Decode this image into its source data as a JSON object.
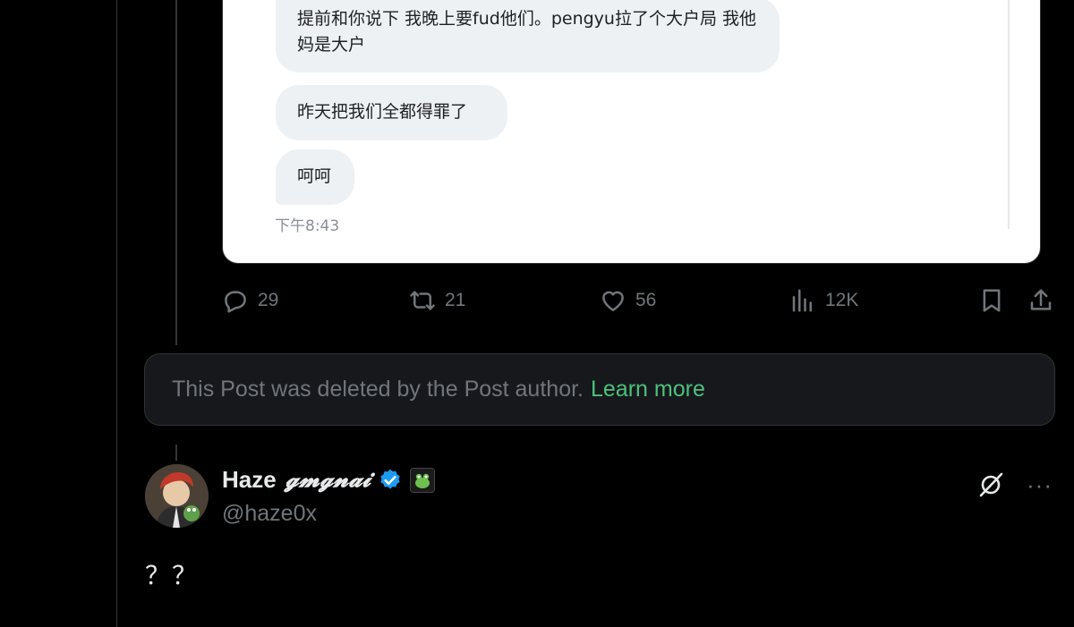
{
  "media": {
    "bubble_1": "提前和你说下 我晚上要fud他们。pengyu拉了个大户局 我他妈是大户",
    "bubble_2": "昨天把我们全都得罪了",
    "bubble_3": "呵呵",
    "time": "下午8:43"
  },
  "actions": {
    "replies": "29",
    "reposts": "21",
    "likes": "56",
    "views": "12K"
  },
  "deleted_notice": {
    "text": "This Post was deleted by the Post author.",
    "link": "Learn more"
  },
  "author": {
    "name": "Haze",
    "name_fancy": "𝓰𝓶𝓰𝓷𝓪𝓲",
    "handle": "@haze0x"
  },
  "tweet": {
    "text": "？？"
  },
  "colors": {
    "background": "#000000",
    "muted": "#71767b",
    "link": "#4ec07c",
    "verified": "#1d9bf0"
  },
  "icons": [
    "reply-icon",
    "repost-icon",
    "like-icon",
    "views-icon",
    "bookmark-icon",
    "share-icon",
    "verified-icon",
    "grok-icon",
    "more-icon"
  ]
}
